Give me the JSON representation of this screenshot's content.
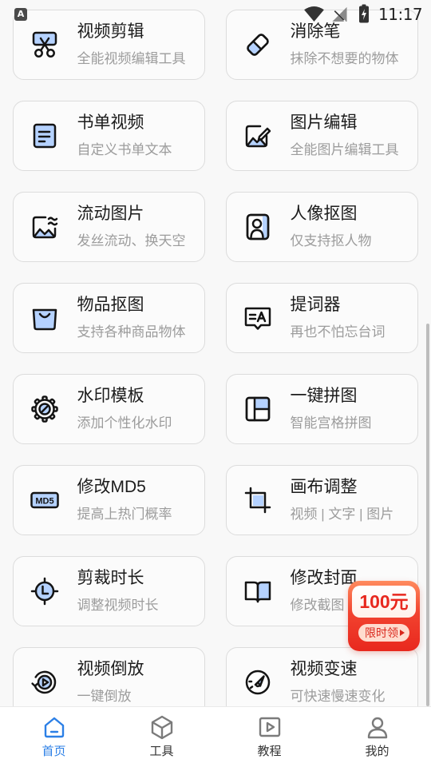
{
  "status_bar": {
    "notification_badge": "A",
    "time": "11:17",
    "icons": [
      "wifi-icon",
      "no-signal-icon",
      "battery-charging-icon"
    ]
  },
  "tools": [
    {
      "title": "视频剪辑",
      "subtitle": "全能视频编辑工具",
      "icon": "video-scissors-icon"
    },
    {
      "title": "消除笔",
      "subtitle": "抹除不想要的物体",
      "icon": "eraser-icon"
    },
    {
      "title": "书单视频",
      "subtitle": "自定义书单文本",
      "icon": "book-list-icon"
    },
    {
      "title": "图片编辑",
      "subtitle": "全能图片编辑工具",
      "icon": "image-edit-icon"
    },
    {
      "title": "流动图片",
      "subtitle": "发丝流动、换天空",
      "icon": "flowing-image-icon"
    },
    {
      "title": "人像抠图",
      "subtitle": "仅支持抠人物",
      "icon": "portrait-cutout-icon"
    },
    {
      "title": "物品抠图",
      "subtitle": "支持各种商品物体",
      "icon": "bag-cutout-icon"
    },
    {
      "title": "提词器",
      "subtitle": "再也不怕忘台词",
      "icon": "teleprompter-icon"
    },
    {
      "title": "水印模板",
      "subtitle": "添加个性化水印",
      "icon": "watermark-badge-icon"
    },
    {
      "title": "一键拼图",
      "subtitle": "智能宫格拼图",
      "icon": "collage-grid-icon"
    },
    {
      "title": "修改MD5",
      "subtitle": "提高上热门概率",
      "icon": "md5-icon",
      "icon_text": "MD5"
    },
    {
      "title": "画布调整",
      "subtitle": "视频 | 文字 | 图片",
      "icon": "crop-canvas-icon"
    },
    {
      "title": "剪裁时长",
      "subtitle": "调整视频时长",
      "icon": "trim-duration-icon"
    },
    {
      "title": "修改封面",
      "subtitle": "修改截图",
      "icon": "cover-book-icon"
    },
    {
      "title": "视频倒放",
      "subtitle": "一键倒放",
      "icon": "reverse-play-icon"
    },
    {
      "title": "视频变速",
      "subtitle": "可快速慢速变化",
      "icon": "speedometer-icon"
    }
  ],
  "promo_badge": {
    "amount": "100元",
    "label": "限时领",
    "icon": "arrow-right-icon"
  },
  "bottom_nav": [
    {
      "label": "首页",
      "icon": "home-icon",
      "active": true
    },
    {
      "label": "工具",
      "icon": "cube-icon",
      "active": false
    },
    {
      "label": "教程",
      "icon": "play-video-icon",
      "active": false
    },
    {
      "label": "我的",
      "icon": "profile-icon",
      "active": false
    }
  ],
  "colors": {
    "accent": "#2b7fe6",
    "icon_fill": "#b5d2ff",
    "card_border": "#dcdcdc",
    "promo_red": "#e8281e"
  }
}
